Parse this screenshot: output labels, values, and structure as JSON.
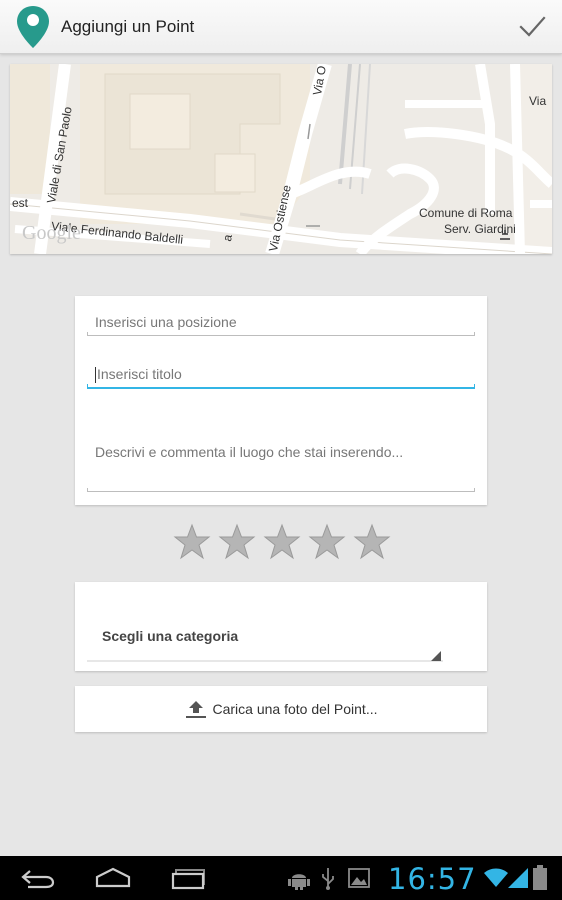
{
  "action_bar": {
    "title": "Aggiungi un Point",
    "app_icon": "map-pin-icon",
    "confirm_icon": "checkmark-icon",
    "accent_color": "#2a9d8f"
  },
  "map": {
    "labels": {
      "viale_san_paolo": "Viale di San Paolo",
      "viale_baldelli": "Viale Ferdinando Baldelli",
      "via_ostiense": "Via Ostiense",
      "via_top": "Via O",
      "via_right": "Via",
      "est": "est",
      "comune_line1": "Comune di Roma",
      "comune_line2": "Serv. Giardini",
      "a_letter": "a"
    },
    "logo": "Google"
  },
  "form": {
    "position_placeholder": "Inserisci una posizione",
    "title_placeholder": "Inserisci titolo",
    "description_placeholder": "Descrivi e commenta il luogo che stai inserendo..."
  },
  "rating": {
    "value": 0,
    "max": 5,
    "star_color": "#b5b5b5"
  },
  "category": {
    "selected": "Scegli una categoria"
  },
  "upload": {
    "label": "Carica una foto del Point...",
    "icon": "upload-icon"
  },
  "system_bar": {
    "time": "16:57",
    "accent_color": "#33b5e5",
    "nav_icons": [
      "back-icon",
      "home-icon",
      "recent-apps-icon"
    ],
    "notification_icons": [
      "android-debug-icon",
      "usb-icon",
      "image-icon"
    ],
    "status_icons": [
      "wifi-icon",
      "signal-icon",
      "battery-icon"
    ]
  }
}
